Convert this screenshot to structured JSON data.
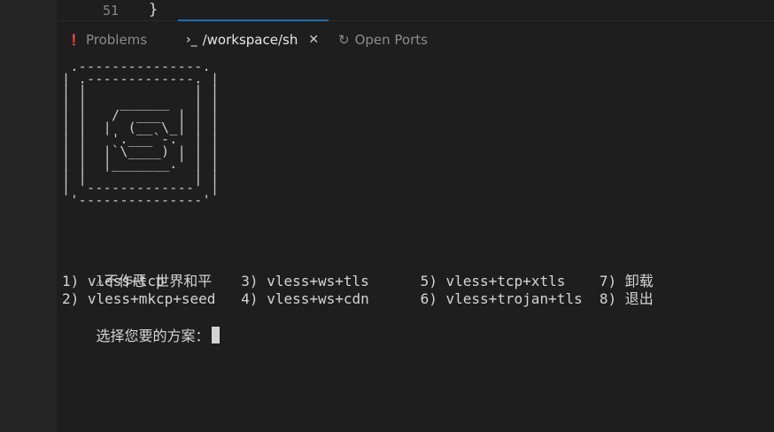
{
  "editor": {
    "line_number": "51",
    "code": "}"
  },
  "panel": {
    "tabs": [
      {
        "label": "Problems",
        "icon": "info-circle-icon"
      },
      {
        "label": "/workspace/sh",
        "icon": "terminal-prompt-icon",
        "active": true
      },
      {
        "label": "Open Ports",
        "icon": "ports-icon"
      }
    ]
  },
  "terminal": {
    "ascii_art": " .---------------.\n| .-------------. |\n| |             | |\n| |    ______   | |\n| |   /  ___  | | |\n| |  |  (__ \\_| | |\n| |   '.___`-.  | |\n| |  |`\\____) | | |\n| |  |_______.' | |\n| |             | |\n| '-------------' |\n '---------------'",
    "slogan": "不作恶 世界和平",
    "menu_line1": "1) vless+tcp         3) vless+ws+tls      5) vless+tcp+xtls    7) 卸载",
    "menu_line2": "2) vless+mkcp+seed   4) vless+ws+cdn      6) vless+trojan+tls  8) 退出",
    "prompt": "选择您要的方案："
  },
  "colors": {
    "accent": "#1f6fb2",
    "background": "#1e1e1e",
    "text": "#d4d4d4"
  }
}
